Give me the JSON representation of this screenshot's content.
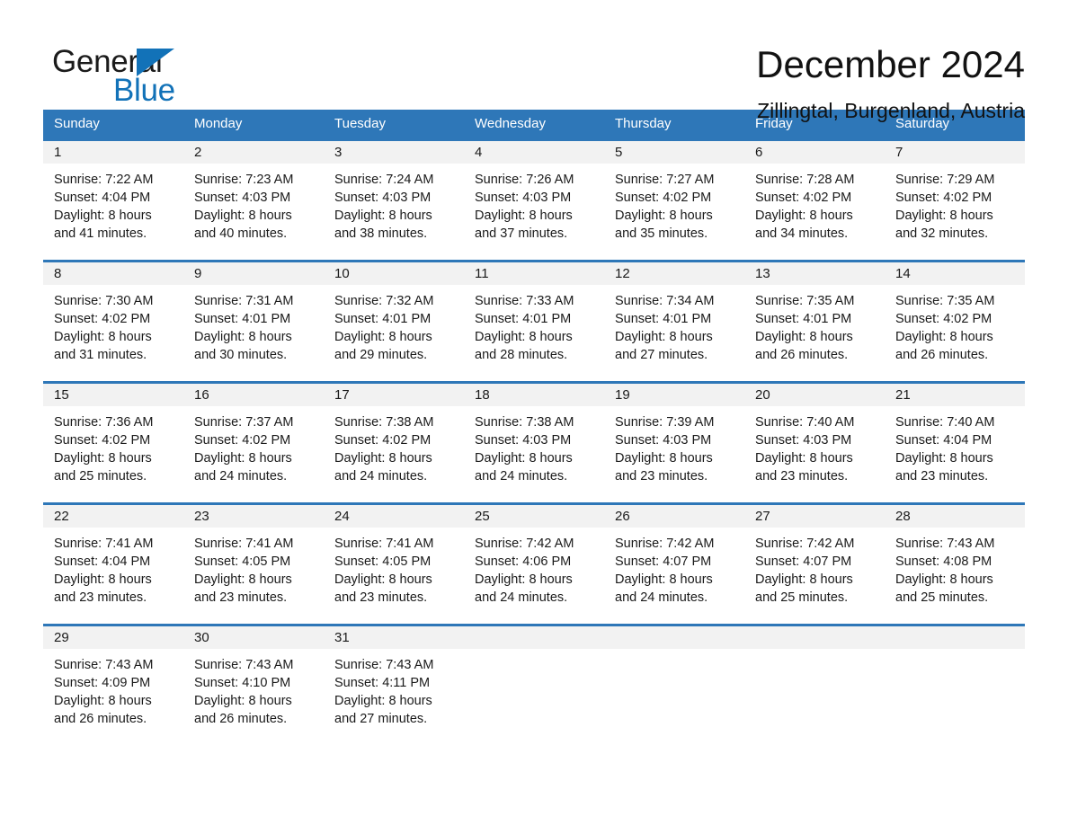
{
  "brand": {
    "name_top": "General",
    "name_bottom": "Blue",
    "triangle_color": "#1272b8"
  },
  "header": {
    "title": "December 2024",
    "subtitle": "Zillingtal, Burgenland, Austria"
  },
  "colors": {
    "header_blue": "#2e77b8",
    "day_band": "#f2f2f2",
    "text": "#1a1a1a"
  },
  "weekdays": [
    "Sunday",
    "Monday",
    "Tuesday",
    "Wednesday",
    "Thursday",
    "Friday",
    "Saturday"
  ],
  "weeks": [
    [
      {
        "day": "1",
        "sunrise": "Sunrise: 7:22 AM",
        "sunset": "Sunset: 4:04 PM",
        "daylight_1": "Daylight: 8 hours",
        "daylight_2": "and 41 minutes."
      },
      {
        "day": "2",
        "sunrise": "Sunrise: 7:23 AM",
        "sunset": "Sunset: 4:03 PM",
        "daylight_1": "Daylight: 8 hours",
        "daylight_2": "and 40 minutes."
      },
      {
        "day": "3",
        "sunrise": "Sunrise: 7:24 AM",
        "sunset": "Sunset: 4:03 PM",
        "daylight_1": "Daylight: 8 hours",
        "daylight_2": "and 38 minutes."
      },
      {
        "day": "4",
        "sunrise": "Sunrise: 7:26 AM",
        "sunset": "Sunset: 4:03 PM",
        "daylight_1": "Daylight: 8 hours",
        "daylight_2": "and 37 minutes."
      },
      {
        "day": "5",
        "sunrise": "Sunrise: 7:27 AM",
        "sunset": "Sunset: 4:02 PM",
        "daylight_1": "Daylight: 8 hours",
        "daylight_2": "and 35 minutes."
      },
      {
        "day": "6",
        "sunrise": "Sunrise: 7:28 AM",
        "sunset": "Sunset: 4:02 PM",
        "daylight_1": "Daylight: 8 hours",
        "daylight_2": "and 34 minutes."
      },
      {
        "day": "7",
        "sunrise": "Sunrise: 7:29 AM",
        "sunset": "Sunset: 4:02 PM",
        "daylight_1": "Daylight: 8 hours",
        "daylight_2": "and 32 minutes."
      }
    ],
    [
      {
        "day": "8",
        "sunrise": "Sunrise: 7:30 AM",
        "sunset": "Sunset: 4:02 PM",
        "daylight_1": "Daylight: 8 hours",
        "daylight_2": "and 31 minutes."
      },
      {
        "day": "9",
        "sunrise": "Sunrise: 7:31 AM",
        "sunset": "Sunset: 4:01 PM",
        "daylight_1": "Daylight: 8 hours",
        "daylight_2": "and 30 minutes."
      },
      {
        "day": "10",
        "sunrise": "Sunrise: 7:32 AM",
        "sunset": "Sunset: 4:01 PM",
        "daylight_1": "Daylight: 8 hours",
        "daylight_2": "and 29 minutes."
      },
      {
        "day": "11",
        "sunrise": "Sunrise: 7:33 AM",
        "sunset": "Sunset: 4:01 PM",
        "daylight_1": "Daylight: 8 hours",
        "daylight_2": "and 28 minutes."
      },
      {
        "day": "12",
        "sunrise": "Sunrise: 7:34 AM",
        "sunset": "Sunset: 4:01 PM",
        "daylight_1": "Daylight: 8 hours",
        "daylight_2": "and 27 minutes."
      },
      {
        "day": "13",
        "sunrise": "Sunrise: 7:35 AM",
        "sunset": "Sunset: 4:01 PM",
        "daylight_1": "Daylight: 8 hours",
        "daylight_2": "and 26 minutes."
      },
      {
        "day": "14",
        "sunrise": "Sunrise: 7:35 AM",
        "sunset": "Sunset: 4:02 PM",
        "daylight_1": "Daylight: 8 hours",
        "daylight_2": "and 26 minutes."
      }
    ],
    [
      {
        "day": "15",
        "sunrise": "Sunrise: 7:36 AM",
        "sunset": "Sunset: 4:02 PM",
        "daylight_1": "Daylight: 8 hours",
        "daylight_2": "and 25 minutes."
      },
      {
        "day": "16",
        "sunrise": "Sunrise: 7:37 AM",
        "sunset": "Sunset: 4:02 PM",
        "daylight_1": "Daylight: 8 hours",
        "daylight_2": "and 24 minutes."
      },
      {
        "day": "17",
        "sunrise": "Sunrise: 7:38 AM",
        "sunset": "Sunset: 4:02 PM",
        "daylight_1": "Daylight: 8 hours",
        "daylight_2": "and 24 minutes."
      },
      {
        "day": "18",
        "sunrise": "Sunrise: 7:38 AM",
        "sunset": "Sunset: 4:03 PM",
        "daylight_1": "Daylight: 8 hours",
        "daylight_2": "and 24 minutes."
      },
      {
        "day": "19",
        "sunrise": "Sunrise: 7:39 AM",
        "sunset": "Sunset: 4:03 PM",
        "daylight_1": "Daylight: 8 hours",
        "daylight_2": "and 23 minutes."
      },
      {
        "day": "20",
        "sunrise": "Sunrise: 7:40 AM",
        "sunset": "Sunset: 4:03 PM",
        "daylight_1": "Daylight: 8 hours",
        "daylight_2": "and 23 minutes."
      },
      {
        "day": "21",
        "sunrise": "Sunrise: 7:40 AM",
        "sunset": "Sunset: 4:04 PM",
        "daylight_1": "Daylight: 8 hours",
        "daylight_2": "and 23 minutes."
      }
    ],
    [
      {
        "day": "22",
        "sunrise": "Sunrise: 7:41 AM",
        "sunset": "Sunset: 4:04 PM",
        "daylight_1": "Daylight: 8 hours",
        "daylight_2": "and 23 minutes."
      },
      {
        "day": "23",
        "sunrise": "Sunrise: 7:41 AM",
        "sunset": "Sunset: 4:05 PM",
        "daylight_1": "Daylight: 8 hours",
        "daylight_2": "and 23 minutes."
      },
      {
        "day": "24",
        "sunrise": "Sunrise: 7:41 AM",
        "sunset": "Sunset: 4:05 PM",
        "daylight_1": "Daylight: 8 hours",
        "daylight_2": "and 23 minutes."
      },
      {
        "day": "25",
        "sunrise": "Sunrise: 7:42 AM",
        "sunset": "Sunset: 4:06 PM",
        "daylight_1": "Daylight: 8 hours",
        "daylight_2": "and 24 minutes."
      },
      {
        "day": "26",
        "sunrise": "Sunrise: 7:42 AM",
        "sunset": "Sunset: 4:07 PM",
        "daylight_1": "Daylight: 8 hours",
        "daylight_2": "and 24 minutes."
      },
      {
        "day": "27",
        "sunrise": "Sunrise: 7:42 AM",
        "sunset": "Sunset: 4:07 PM",
        "daylight_1": "Daylight: 8 hours",
        "daylight_2": "and 25 minutes."
      },
      {
        "day": "28",
        "sunrise": "Sunrise: 7:43 AM",
        "sunset": "Sunset: 4:08 PM",
        "daylight_1": "Daylight: 8 hours",
        "daylight_2": "and 25 minutes."
      }
    ],
    [
      {
        "day": "29",
        "sunrise": "Sunrise: 7:43 AM",
        "sunset": "Sunset: 4:09 PM",
        "daylight_1": "Daylight: 8 hours",
        "daylight_2": "and 26 minutes."
      },
      {
        "day": "30",
        "sunrise": "Sunrise: 7:43 AM",
        "sunset": "Sunset: 4:10 PM",
        "daylight_1": "Daylight: 8 hours",
        "daylight_2": "and 26 minutes."
      },
      {
        "day": "31",
        "sunrise": "Sunrise: 7:43 AM",
        "sunset": "Sunset: 4:11 PM",
        "daylight_1": "Daylight: 8 hours",
        "daylight_2": "and 27 minutes."
      },
      {
        "day": "",
        "sunrise": "",
        "sunset": "",
        "daylight_1": "",
        "daylight_2": ""
      },
      {
        "day": "",
        "sunrise": "",
        "sunset": "",
        "daylight_1": "",
        "daylight_2": ""
      },
      {
        "day": "",
        "sunrise": "",
        "sunset": "",
        "daylight_1": "",
        "daylight_2": ""
      },
      {
        "day": "",
        "sunrise": "",
        "sunset": "",
        "daylight_1": "",
        "daylight_2": ""
      }
    ]
  ]
}
